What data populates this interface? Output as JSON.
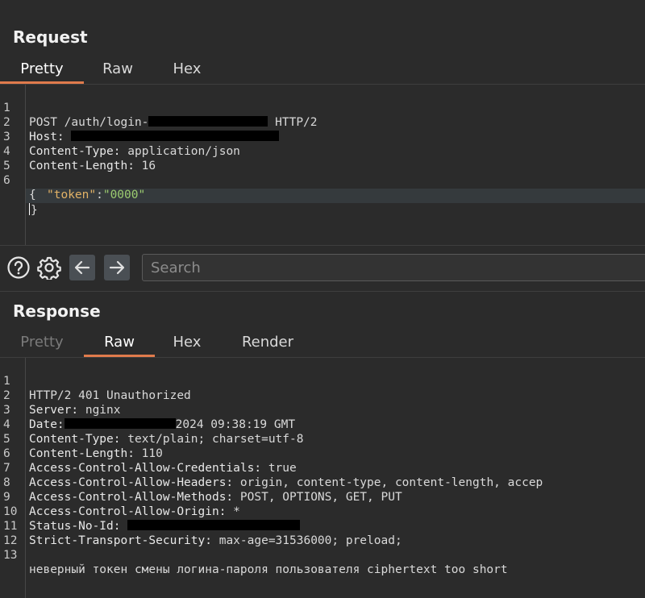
{
  "request": {
    "title": "Request",
    "tabs": [
      "Pretty",
      "Raw",
      "Hex"
    ],
    "lines": {
      "l1_method": "POST /auth/login-",
      "l1_proto": " HTTP/2",
      "l2_name": "Host:",
      "l3_name": "Content-Type:",
      "l3_value": " application/json",
      "l4_name": "Content-Length:",
      "l4_value": " 16",
      "l6": "{",
      "l7_key": "\"token\"",
      "l7_colon": ":",
      "l7_value": "\"0000\"",
      "l8": "}"
    },
    "line_numbers": [
      "1",
      "2",
      "3",
      "4",
      "5",
      "6"
    ]
  },
  "toolbar": {
    "help_icon": "question-circle-icon",
    "settings_icon": "gear-icon",
    "back_icon": "arrow-left-icon",
    "forward_icon": "arrow-right-icon",
    "search_placeholder": "Search"
  },
  "response": {
    "title": "Response",
    "tabs": [
      "Pretty",
      "Raw",
      "Hex",
      "Render"
    ],
    "line_numbers": [
      "1",
      "2",
      "3",
      "4",
      "5",
      "6",
      "7",
      "8",
      "9",
      "10",
      "11",
      "12",
      "13"
    ],
    "lines": {
      "l1": "HTTP/2 401 Unauthorized",
      "l2_name": "Server:",
      "l2_value": " nginx",
      "l3_name": "Date:",
      "l3_value": "2024 09:38:19 GMT",
      "l4_name": "Content-Type:",
      "l4_value": " text/plain; charset=utf-8",
      "l5_name": "Content-Length:",
      "l5_value": " 110",
      "l6_name": "Access-Control-Allow-Credentials:",
      "l6_value": " true",
      "l7_name": "Access-Control-Allow-Headers:",
      "l7_value": " origin, content-type, content-length, accep",
      "l8_name": "Access-Control-Allow-Methods:",
      "l8_value": " POST, OPTIONS, GET, PUT",
      "l9_name": "Access-Control-Allow-Origin:",
      "l9_value": " *",
      "l10_name": "Status-No-Id:",
      "l11_name": "Strict-Transport-Security:",
      "l11_value": " max-age=31536000; preload;",
      "l13": "неверный токен смены логина-пароля пользователя ciphertext too short"
    }
  },
  "colors": {
    "background": "#2b2b2b",
    "accent_underline": "#e07b4c",
    "json_key": "#e2b266",
    "json_string": "#9ccc70"
  }
}
